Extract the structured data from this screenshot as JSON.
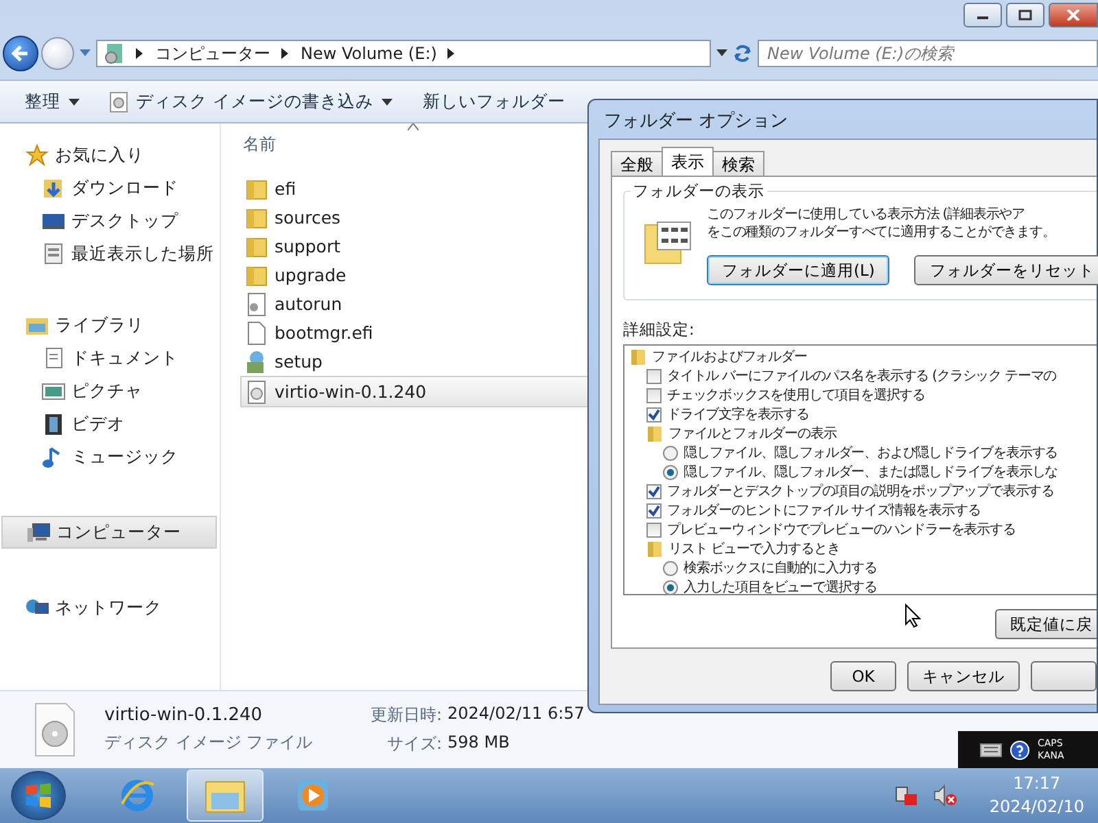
{
  "window": {
    "breadcrumb": [
      "コンピューター",
      "New Volume (E:)"
    ],
    "search": {
      "placeholder": "New Volume (E:)の検索"
    }
  },
  "toolbar": [
    {
      "label": "整理",
      "kind": "menu"
    },
    {
      "label": "ディスク イメージの書き込み",
      "kind": "disc-menu"
    },
    {
      "label": "新しいフォルダー",
      "kind": "plain"
    }
  ],
  "sidebar": {
    "groups": [
      {
        "label": "お気に入り",
        "kind": "star",
        "selected": false,
        "children": [
          {
            "label": "ダウンロード",
            "kind": "download",
            "selected": false
          },
          {
            "label": "デスクトップ",
            "kind": "desktop",
            "selected": false
          },
          {
            "label": "最近表示した場所",
            "kind": "recent",
            "selected": false
          }
        ]
      },
      {
        "label": "ライブラリ",
        "kind": "library",
        "selected": false,
        "children": [
          {
            "label": "ドキュメント",
            "kind": "document",
            "selected": false
          },
          {
            "label": "ピクチャ",
            "kind": "picture",
            "selected": false
          },
          {
            "label": "ビデオ",
            "kind": "video",
            "selected": false
          },
          {
            "label": "ミュージック",
            "kind": "music",
            "selected": false
          }
        ]
      },
      {
        "label": "コンピューター",
        "kind": "computer",
        "selected": true
      },
      {
        "label": "ネットワーク",
        "kind": "network",
        "selected": false
      }
    ]
  },
  "file_list": {
    "column": "名前",
    "files": [
      {
        "name": "efi",
        "kind": "folder",
        "selected": false
      },
      {
        "name": "sources",
        "kind": "folder",
        "selected": false
      },
      {
        "name": "support",
        "kind": "folder",
        "selected": false
      },
      {
        "name": "upgrade",
        "kind": "folder",
        "selected": false
      },
      {
        "name": "autorun",
        "kind": "settings",
        "selected": false
      },
      {
        "name": "bootmgr.efi",
        "kind": "file",
        "selected": false
      },
      {
        "name": "setup",
        "kind": "setup",
        "selected": false
      },
      {
        "name": "virtio-win-0.1.240",
        "kind": "disc",
        "selected": true
      }
    ]
  },
  "details": {
    "name": "virtio-win-0.1.240",
    "type": "ディスク イメージ ファイル",
    "fields": [
      {
        "label": "更新日時:",
        "value": "2024/02/11 6:57"
      },
      {
        "label": "サイズ:",
        "value": "598 MB"
      }
    ]
  },
  "dialog": {
    "title": "フォルダー オプション",
    "tabs": [
      {
        "label": "全般",
        "selected": false
      },
      {
        "label": "表示",
        "selected": true
      },
      {
        "label": "検索",
        "selected": false
      }
    ],
    "group_title": "フォルダーの表示",
    "description": [
      "このフォルダーに使用している表示方法 (詳細表示やア",
      "をこの種類のフォルダーすべてに適用することができます。"
    ],
    "group_buttons": [
      {
        "label": "フォルダーに適用(L)",
        "focused": true
      },
      {
        "label": "フォルダーをリセット",
        "focused": false
      }
    ],
    "advanced_label": "詳細設定:",
    "advanced": [
      {
        "kind": "folder",
        "label": "ファイルおよびフォルダー",
        "children": [
          {
            "kind": "checkbox",
            "label": "タイトル バーにファイルのパス名を表示する (クラシック テーマの",
            "checked": false
          },
          {
            "kind": "checkbox",
            "label": "チェックボックスを使用して項目を選択する",
            "checked": false
          },
          {
            "kind": "checkbox",
            "label": "ドライブ文字を表示する",
            "checked": true
          },
          {
            "kind": "folder",
            "label": "ファイルとフォルダーの表示",
            "children": [
              {
                "kind": "radio",
                "label": "隠しファイル、隠しフォルダー、および隠しドライブを表示する",
                "checked": false
              },
              {
                "kind": "radio",
                "label": "隠しファイル、隠しフォルダー、または隠しドライブを表示しな",
                "checked": true
              }
            ]
          },
          {
            "kind": "checkbox",
            "label": "フォルダーとデスクトップの項目の説明をポップアップで表示する",
            "checked": true
          },
          {
            "kind": "checkbox",
            "label": "フォルダーのヒントにファイル サイズ情報を表示する",
            "checked": true
          },
          {
            "kind": "checkbox",
            "label": "プレビューウィンドウでプレビューのハンドラーを表示する",
            "checked": false
          },
          {
            "kind": "folder",
            "label": "リスト ビューで入力するとき",
            "children": [
              {
                "kind": "radio",
                "label": "検索ボックスに自動的に入力する",
                "checked": false
              },
              {
                "kind": "radio",
                "label": "入力した項目をビューで選択する",
                "checked": true
              }
            ]
          }
        ]
      }
    ],
    "restore_button": "既定値に戻",
    "buttons": [
      "OK",
      "キャンセル"
    ]
  },
  "language_bar": {
    "caps": "CAPS",
    "kana": "KANA"
  },
  "taskbar": {
    "items": [
      {
        "kind": "browser",
        "selected": false
      },
      {
        "kind": "explorer",
        "selected": true
      },
      {
        "kind": "media",
        "selected": false
      }
    ],
    "time": "17:17",
    "date": "2024/02/10"
  }
}
